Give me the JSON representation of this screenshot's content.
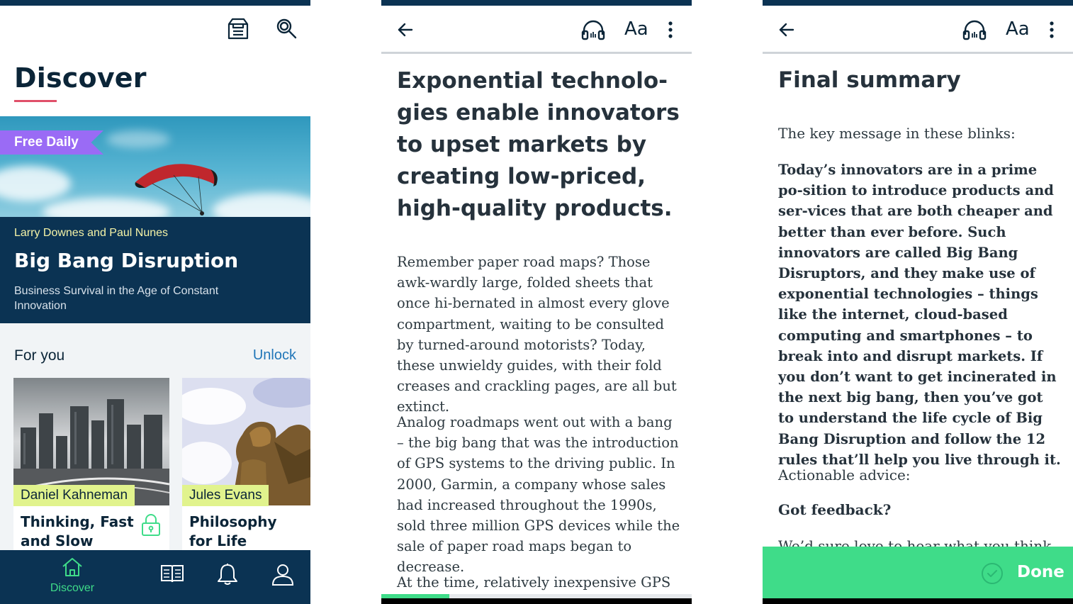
{
  "colors": {
    "navy": "#0b3353",
    "accent_green": "#3fdc89",
    "accent_purple": "#9a6bf5",
    "author_tag_yellow": "#e1f38d",
    "link_blue": "#2176b8",
    "underline_red": "#e0506a"
  },
  "discover": {
    "header_icons": [
      "inbox-icon",
      "search-icon"
    ],
    "title": "Discover",
    "featured": {
      "badge": "Free Daily",
      "authors": "Larry Downes and Paul Nunes",
      "title": "Big Bang Disruption",
      "subtitle": "Business Survival in the Age of Constant Innovation"
    },
    "for_you": {
      "label": "For you",
      "action": "Unlock",
      "cards": [
        {
          "author": "Daniel Kahneman",
          "title": "Thinking, Fast and Slow",
          "locked": true
        },
        {
          "author": "Jules Evans",
          "title": "Philosophy for Life",
          "locked": false
        }
      ]
    },
    "bottom_nav": [
      {
        "label": "Discover",
        "icon": "home-icon",
        "active": true
      },
      {
        "label": "",
        "icon": "library-icon",
        "active": false
      },
      {
        "label": "",
        "icon": "bell-icon",
        "active": false
      },
      {
        "label": "",
        "icon": "profile-icon",
        "active": false
      }
    ]
  },
  "reader": {
    "toolbar": {
      "back_icon": "back-arrow-icon",
      "audio_icon": "headphones-icon",
      "font_label": "Aa",
      "more_icon": "more-vertical-icon"
    },
    "chapter_title": "Exponential technolo-gies enable innovators to upset markets by creating low-priced, high-quality products.",
    "paragraphs": [
      "Remember paper road maps? Those awk-wardly large, folded sheets that once hi-bernated in almost every glove compartment, waiting to be consulted by turned-around motorists? Today, these unwieldy guides, with their fold creases and crackling pages, are all but extinct.",
      "Analog roadmaps went out with a bang – the big bang that was the introduction of GPS systems to the driving public. In 2000, Garmin, a company whose sales had increased throughout the 1990s, sold three million GPS devices while the sale of paper road maps began to decrease.",
      "At the time, relatively inexpensive GPS"
    ],
    "progress": 0.22
  },
  "summary": {
    "toolbar": {
      "back_icon": "back-arrow-icon",
      "audio_icon": "headphones-icon",
      "font_label": "Aa",
      "more_icon": "more-vertical-icon"
    },
    "title": "Final summary",
    "key_message_label": "The key message in these blinks:",
    "key_message": "Today’s innovators are in a prime po-sition to introduce products and ser-vices that are both cheaper and better than ever before. Such innovators are called Big Bang Disruptors, and they make use of exponential technologies – things like the internet, cloud-based computing and smartphones – to break into and disrupt markets. If you don’t want to get incinerated in the next big bang, then you’ve got to understand the life cycle of Big Bang Disruption and follow the 12 rules that’ll help you live through it.",
    "actionable_label": "Actionable advice:",
    "feedback_heading": "Got feedback?",
    "cut_off_line": "We’d sure love to hear what you think",
    "done_label": "Done"
  }
}
